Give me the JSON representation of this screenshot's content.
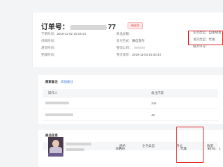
{
  "order": {
    "title_prefix": "订单号：",
    "id_suffix": "77",
    "status": "待发货",
    "col1": [
      {
        "label": "下单时间：",
        "value": "2019-11-02 15:34:44"
      },
      {
        "label": "付款时间：",
        "value": ""
      },
      {
        "label": "发货时间：",
        "value": ""
      },
      {
        "label": "完成时间：",
        "value": ""
      }
    ],
    "col2": [
      {
        "label": "商品总额：",
        "value": ""
      },
      {
        "label": "支付方式：",
        "value": "微信支付"
      },
      {
        "label": "物流公司：",
        "value": ""
      },
      {
        "label": "预计发货：",
        "value": "2019-11-03 15:34:44"
      }
    ],
    "col3": [
      {
        "label": "业务类型：",
        "value": "自主经营"
      },
      {
        "label": "发货类型：",
        "value": "代发"
      },
      {
        "label": "服务单号：",
        "value": ""
      }
    ]
  },
  "remarks": {
    "title": "商家备注",
    "link": "添加备注",
    "headers": {
      "operator": "操作人",
      "content": "备注内容"
    },
    "rows": [
      {
        "content": "345"
      },
      {
        "content": "45"
      }
    ]
  },
  "goods": {
    "title": "商品信息",
    "headers": {
      "info": "商品信息",
      "spec": "规格",
      "biz": "业务类型",
      "price": "单价",
      "qty": "数量"
    },
    "row": {
      "spec": "白色M",
      "biz": "代发",
      "price": "¥0.01",
      "qty": "1"
    }
  },
  "colors": {
    "accent_red": "#e0262a",
    "link_blue": "#3d7ad6",
    "badge_red": "#e04444"
  }
}
